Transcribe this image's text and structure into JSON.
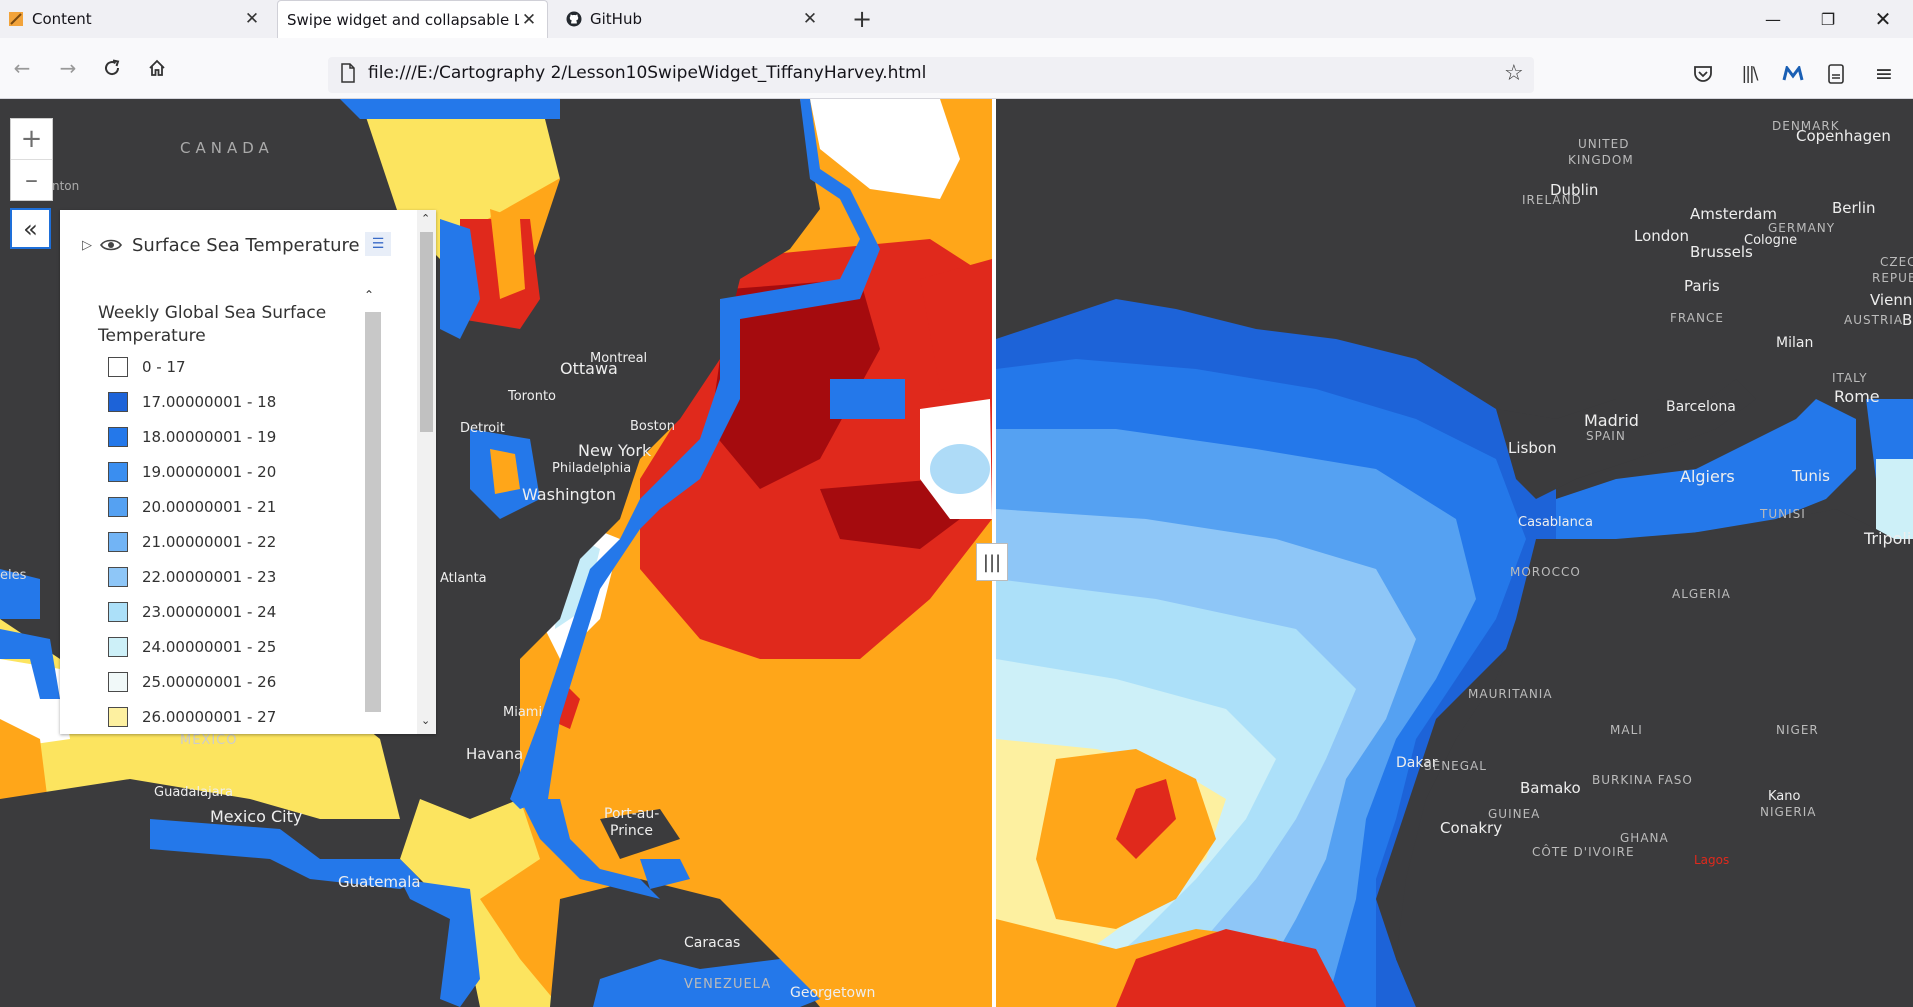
{
  "tabs": [
    {
      "label": "Content",
      "icon": "content-favicon-icon",
      "active": false
    },
    {
      "label": "Swipe widget and collapsable Lege",
      "icon": "",
      "active": true
    },
    {
      "label": "GitHub",
      "icon": "github-icon",
      "active": false
    }
  ],
  "address": {
    "url": "file:///E:/Cartography 2/Lesson10SwipeWidget_TiffanyHarvey.html"
  },
  "legend": {
    "layer_name": "Surface Sea Temperature",
    "title": "Weekly Global Sea Surface Temperature",
    "classes": [
      {
        "label": "0 - 17",
        "color": "#ffffff"
      },
      {
        "label": "17.00000001 - 18",
        "color": "#1d63d8"
      },
      {
        "label": "18.00000001 - 19",
        "color": "#2478ea"
      },
      {
        "label": "19.00000001 - 20",
        "color": "#3a8ef0"
      },
      {
        "label": "20.00000001 - 21",
        "color": "#55a1f2"
      },
      {
        "label": "21.00000001 - 22",
        "color": "#72b4f5"
      },
      {
        "label": "22.00000001 - 23",
        "color": "#8ec6f7"
      },
      {
        "label": "23.00000001 - 24",
        "color": "#ace0f9"
      },
      {
        "label": "24.00000001 - 25",
        "color": "#cdf0f8"
      },
      {
        "label": "25.00000001 - 26",
        "color": "#f1f9f9"
      },
      {
        "label": "26.00000001 - 27",
        "color": "#fdf0a0"
      }
    ]
  },
  "map_labels_left": {
    "canada": "CANADA",
    "ottawa": "Ottawa",
    "montreal": "Montreal",
    "toronto": "Toronto",
    "detroit": "Detroit",
    "boston": "Boston",
    "new_york": "New York",
    "philadelphia": "Philadelphia",
    "washington": "Washington",
    "atlanta": "Atlanta",
    "miami": "Miami",
    "havana": "Havana",
    "mexico": "MEXICO",
    "guadalajara": "Guadalajara",
    "mexico_city": "Mexico City",
    "guatemala": "Guatemala",
    "port_au_prince_1": "Port-au-",
    "port_au_prince_2": "Prince",
    "caracas": "Caracas",
    "venezuela": "VENEZUELA",
    "georgetown": "Georgetown",
    "edge_nton": "nton",
    "edge_eles": "eles"
  },
  "map_labels_right": {
    "united_kingdom_1": "UNITED",
    "united_kingdom_2": "KINGDOM",
    "ireland": "IRELAND",
    "dublin": "Dublin",
    "denmark": "DENMARK",
    "copenhagen": "Copenhagen",
    "amsterdam": "Amsterdam",
    "london": "London",
    "brussels": "Brussels",
    "cologne": "Cologne",
    "germany": "GERMANY",
    "berlin": "Berlin",
    "czech_1": "CZECH",
    "czech_2": "REPUBLI",
    "vienna": "Vienna",
    "austria": "AUSTRIA",
    "paris": "Paris",
    "france": "FRANCE",
    "milan": "Milan",
    "italy": "ITALY",
    "rome": "Rome",
    "barcelona": "Barcelona",
    "madrid": "Madrid",
    "spain": "SPAIN",
    "lisbon": "Lisbon",
    "algiers": "Algiers",
    "tunis": "Tunis",
    "tunisia": "TUNISI",
    "tripoli": "Tripoli",
    "casablanca": "Casablanca",
    "morocco": "MOROCCO",
    "algeria": "ALGERIA",
    "mauritania": "MAURITANIA",
    "mali": "MALI",
    "niger": "NIGER",
    "dakar": "Dakar",
    "senegal": "SENEGAL",
    "bamako": "Bamako",
    "burkina_faso": "BURKINA FASO",
    "kano": "Kano",
    "nigeria": "NIGERIA",
    "guinea": "GUINEA",
    "conakry": "Conakry",
    "ghana": "GHANA",
    "cote_divoire": "CÔTE D'IVOIRE",
    "lagos": "Lagos",
    "b_edge": "B"
  }
}
